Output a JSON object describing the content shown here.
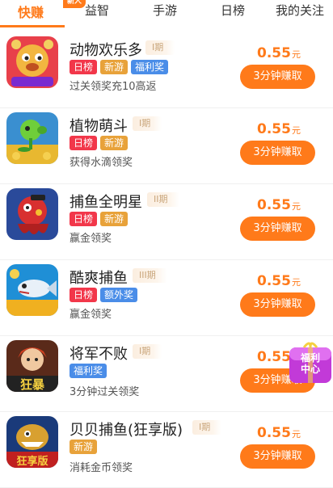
{
  "tabs": [
    {
      "label": "快赚",
      "active": true,
      "badge": "新人"
    },
    {
      "label": "益智"
    },
    {
      "label": "手游"
    },
    {
      "label": "日榜"
    },
    {
      "label": "我的关注"
    }
  ],
  "games": [
    {
      "name": "动物欢乐多",
      "period": "I期",
      "tags": [
        "日榜",
        "新游",
        "福利奖"
      ],
      "desc": "过关领奖充10高返",
      "reward": "0.55",
      "unit": "元",
      "button": "3分钟赚取",
      "icon": "animal-game-icon"
    },
    {
      "name": "植物萌斗",
      "period": "I期",
      "tags": [
        "日榜",
        "新游"
      ],
      "desc": "获得水滴领奖",
      "reward": "0.55",
      "unit": "元",
      "button": "3分钟赚取",
      "icon": "plant-game-icon"
    },
    {
      "name": "捕鱼全明星",
      "period": "II期",
      "tags": [
        "日榜",
        "新游"
      ],
      "desc": "赢金领奖",
      "reward": "0.55",
      "unit": "元",
      "button": "3分钟赚取",
      "icon": "fishing-star-game-icon"
    },
    {
      "name": "酷爽捕鱼",
      "period": "III期",
      "tags": [
        "日榜",
        "额外奖"
      ],
      "desc": "赢金领奖",
      "reward": "0.55",
      "unit": "元",
      "button": "3分钟赚取",
      "icon": "cool-fishing-game-icon"
    },
    {
      "name": "将军不败",
      "period": "I期",
      "tags": [
        "福利奖"
      ],
      "desc": "3分钟过关领奖",
      "reward": "0.55",
      "unit": "元",
      "button": "3分钟赚取",
      "icon": "general-game-icon",
      "icon_text": "狂暴"
    },
    {
      "name": "贝贝捕鱼(狂享版)",
      "period": "I期",
      "tags": [
        "新游"
      ],
      "desc": "消耗金币领奖",
      "reward": "0.55",
      "unit": "元",
      "button": "3分钟赚取",
      "icon": "beibei-fishing-game-icon",
      "icon_text": "狂享版"
    }
  ],
  "float_badge": {
    "line1": "福利",
    "line2": "中心"
  },
  "colors": {
    "accent": "#ff7a1a",
    "tag_red": "#f2374a",
    "tag_gold": "#e8a23a",
    "tag_blue": "#4a8de8"
  }
}
